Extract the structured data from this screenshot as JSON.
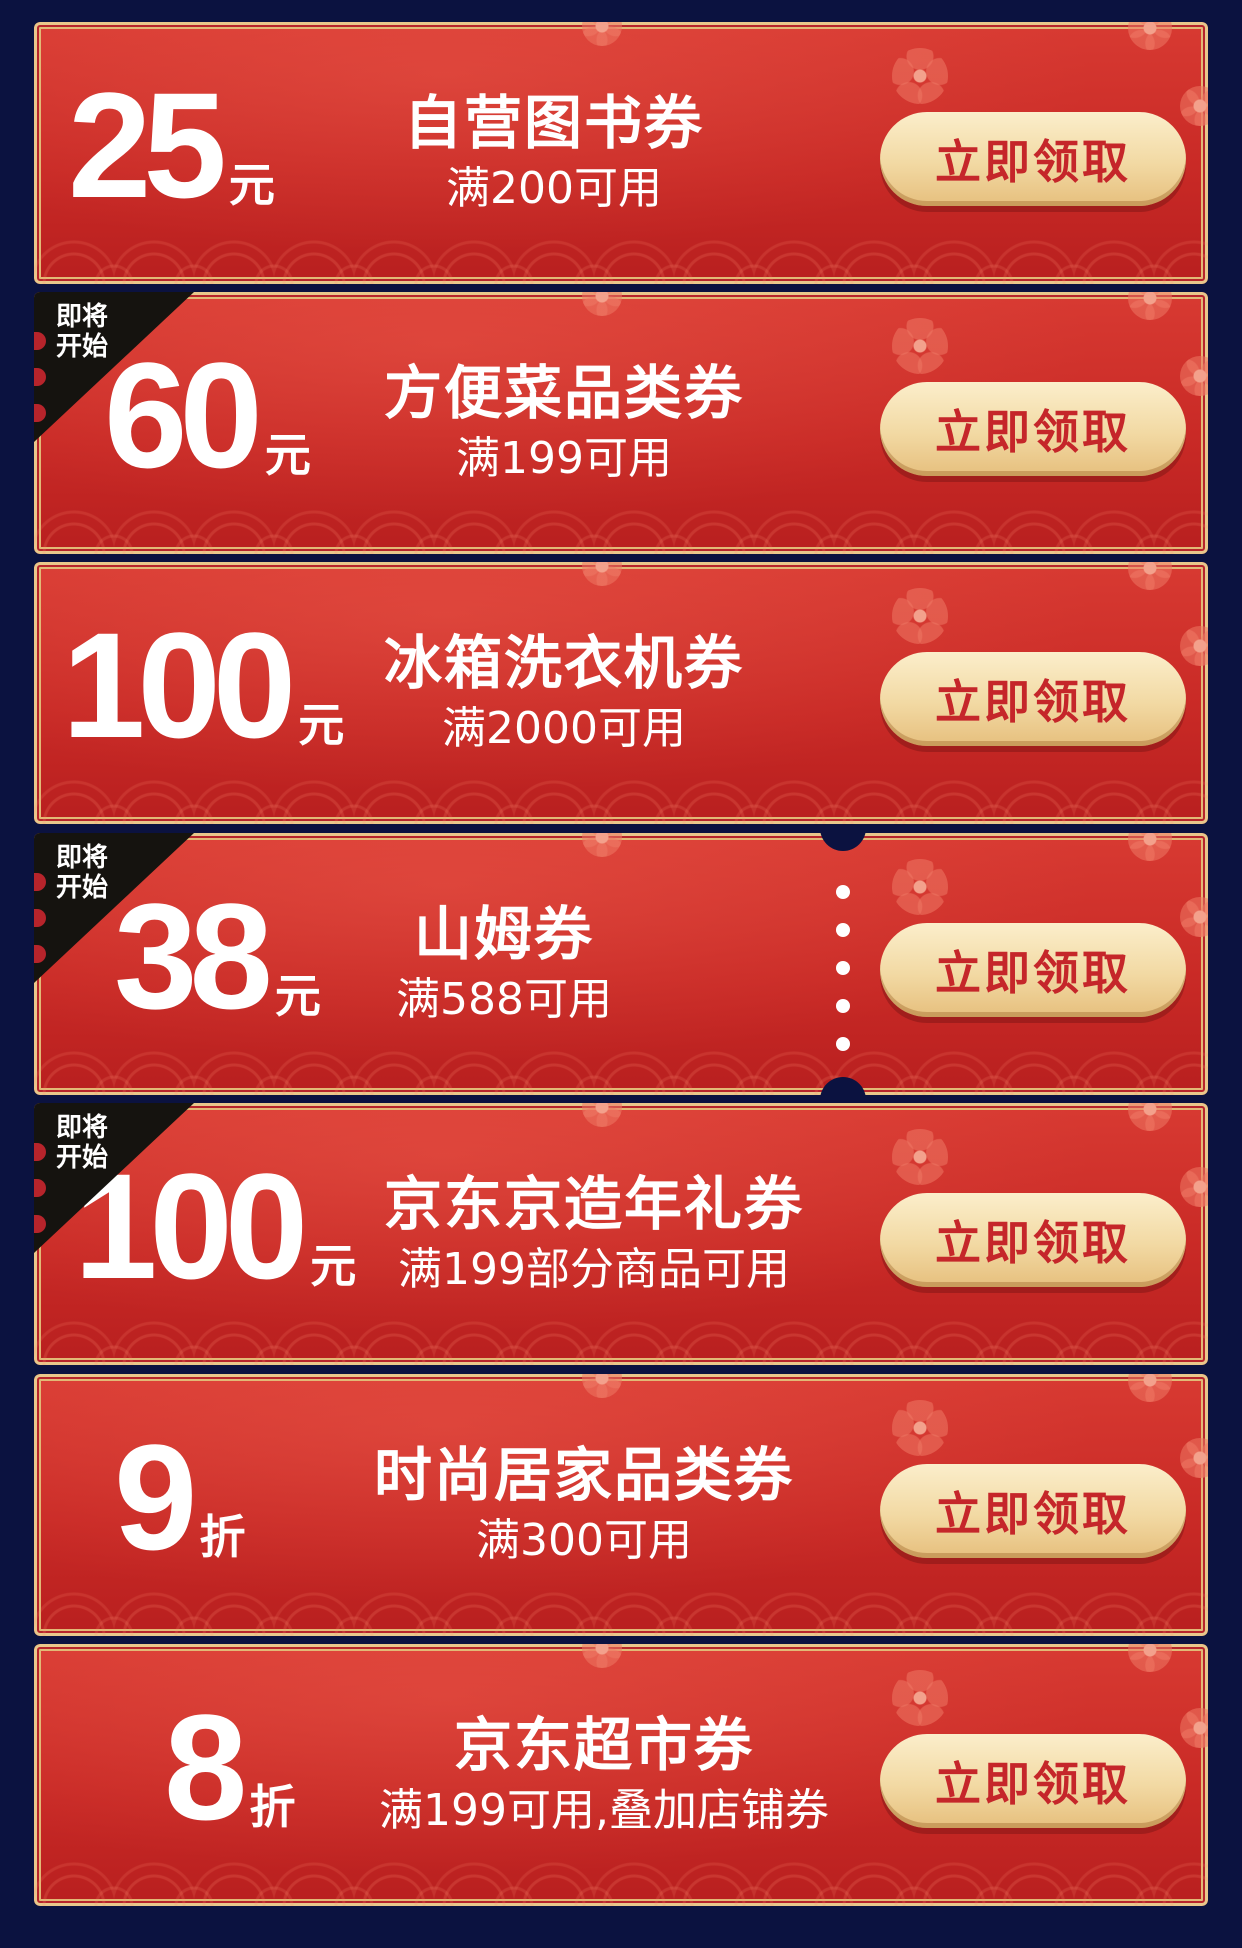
{
  "button_label": "立即领取",
  "ribbon_label": "即将\n开始",
  "coupons": [
    {
      "amount": "25",
      "unit": "元",
      "title": "自营图书券",
      "condition": "满200可用",
      "upcoming": false,
      "perforated": false
    },
    {
      "amount": "60",
      "unit": "元",
      "title": "方便菜品类券",
      "condition": "满199可用",
      "upcoming": true,
      "perforated": false
    },
    {
      "amount": "100",
      "unit": "元",
      "title": "冰箱洗衣机券",
      "condition": "满2000可用",
      "upcoming": false,
      "perforated": false
    },
    {
      "amount": "38",
      "unit": "元",
      "title": "山姆券",
      "condition": "满588可用",
      "upcoming": true,
      "perforated": true
    },
    {
      "amount": "100",
      "unit": "元",
      "title": "京东京造年礼券",
      "condition": "满199部分商品可用",
      "upcoming": true,
      "perforated": false
    },
    {
      "amount": "9",
      "unit": "折",
      "title": "时尚居家品类券",
      "condition": "满300可用",
      "upcoming": false,
      "perforated": false
    },
    {
      "amount": "8",
      "unit": "折",
      "title": "京东超市券",
      "condition": "满199可用,叠加店铺券",
      "upcoming": false,
      "perforated": false
    }
  ],
  "colors": {
    "background": "#0b1240",
    "coupon_red": "#c92a26",
    "button_gold": "#f2d9a3",
    "button_text": "#c5262a"
  },
  "icons": [
    "plum-blossom-icon",
    "wave-pattern"
  ]
}
